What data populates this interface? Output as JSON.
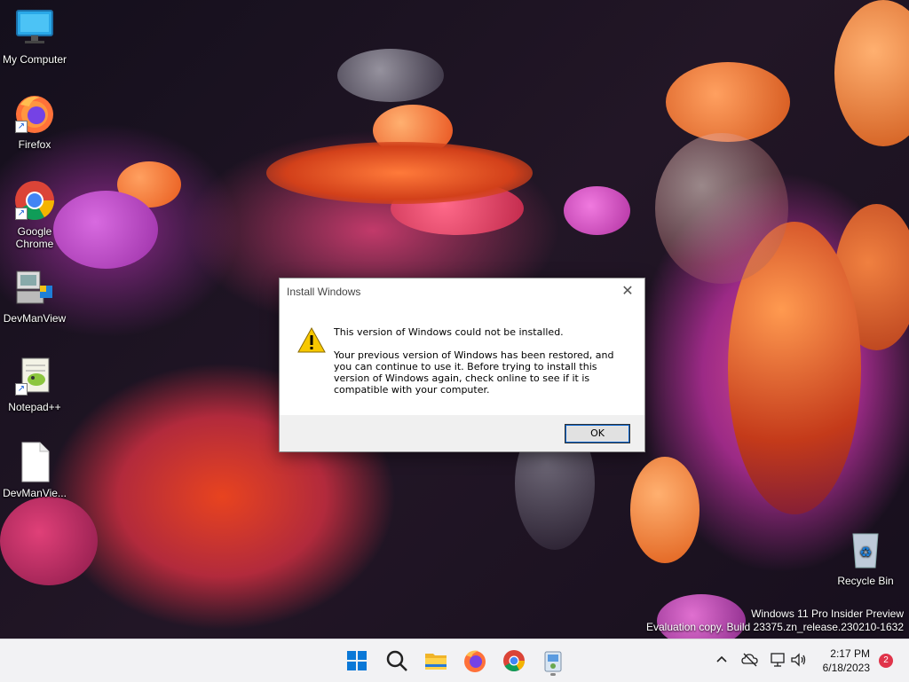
{
  "desktop": {
    "icons": [
      {
        "label": "My Computer"
      },
      {
        "label": "Firefox"
      },
      {
        "label": "Google Chrome"
      },
      {
        "label": "DevManView"
      },
      {
        "label": "Notepad++"
      },
      {
        "label": "DevManVie..."
      },
      {
        "label": "Recycle Bin"
      }
    ]
  },
  "dialog": {
    "title": "Install Windows",
    "close_glyph": "✕",
    "heading": "This version of Windows could not be installed.",
    "message": "Your previous version of Windows has been restored, and you can continue to use it.  Before trying to install this version of Windows again, check online to see if it is compatible with your computer.",
    "ok_label": "OK"
  },
  "watermark": {
    "line1": "Windows 11 Pro Insider Preview",
    "line2": "Evaluation copy. Build 23375.zn_release.230210-1632"
  },
  "taskbar": {
    "time": "2:17 PM",
    "date": "6/18/2023",
    "notification_count": "2",
    "apps": [
      "start-icon",
      "search-icon",
      "file-explorer-icon",
      "firefox-icon",
      "chrome-icon",
      "recycle-app-icon"
    ]
  },
  "colors": {
    "accent": "#0a64d0",
    "taskbar_bg": "#f2f2f4",
    "badge": "#e0344a"
  }
}
